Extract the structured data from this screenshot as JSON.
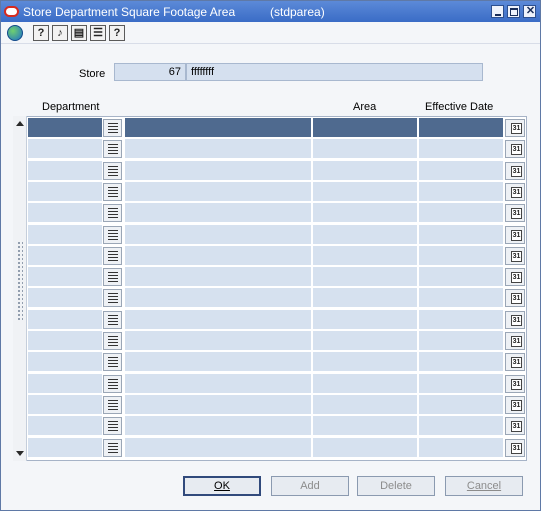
{
  "window": {
    "title": "Store Department Square Footage Area",
    "form_id": "(stdparea)"
  },
  "store": {
    "label": "Store",
    "id": "67",
    "name": "ffffffff"
  },
  "columns": {
    "department": "Department",
    "area": "Area",
    "effective_date": "Effective Date"
  },
  "rows": [
    {
      "selected": true
    },
    {},
    {},
    {},
    {},
    {},
    {},
    {},
    {},
    {},
    {},
    {},
    {},
    {},
    {},
    {}
  ],
  "buttons": {
    "ok": "OK",
    "add": "Add",
    "delete": "Delete",
    "cancel": "Cancel"
  },
  "icons": {
    "toolbar": [
      "globe-icon",
      "help-about-icon",
      "help-keys-icon",
      "clipboard-icon",
      "list-icon",
      "question-icon"
    ],
    "lov": "list-of-values-icon",
    "calendar": "calendar-icon"
  },
  "colors": {
    "titlebar": "#3a6cc6",
    "selected_row": "#4f6a8f",
    "grid_cell": "#d6e1ef"
  }
}
